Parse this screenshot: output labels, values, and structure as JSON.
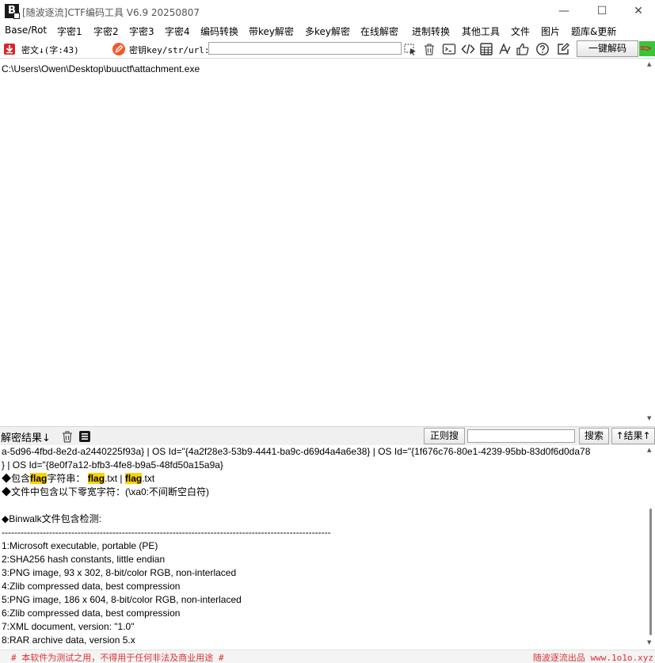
{
  "window": {
    "logo_text": "B",
    "title": "[随波逐流]CTF编码工具 V6.9  20250807",
    "minimize": "—",
    "maximize": "☐",
    "close": "✕"
  },
  "menu": [
    "Base/Rot",
    "字密1",
    "字密2",
    "字密3",
    "字密4",
    "编码转换",
    "带key解密",
    "多key解密",
    "在线解密",
    "进制转换",
    "其他工具",
    "文件",
    "图片",
    "题库&更新"
  ],
  "toolbar": {
    "cipher_label": "密文↓(字:43)",
    "key_label": "密钥key/str/url:",
    "key_value": "",
    "decode_button": "一键解码",
    "run_arrow": "=>"
  },
  "input": {
    "text": "C:\\Users\\Owen\\Desktop\\buuctf\\attachment.exe"
  },
  "result_bar": {
    "label": "解密结果↓",
    "regex_button": "正则搜",
    "search_value": "",
    "search_button": "搜索",
    "nav_button": "↑结果↑"
  },
  "output": {
    "line1": "a-5d96-4fbd-8e2d-a2440225f93a} | OS Id=\"{4a2f28e3-53b9-4441-ba9c-d69d4a4a6e38} | OS Id=\"{1f676c76-80e1-4239-95bb-83d0f6d0da78",
    "line2": "} | OS Id=\"{8e0f7a12-bfb3-4fe8-b9a5-48fd50a15a9a}",
    "flag_prefix": "◆包含",
    "flag_word": "flag",
    "flag_mid": "字符串：",
    "flag_file1_suffix": ".txt | ",
    "flag_file2_suffix": ".txt",
    "zero_width": "◆文件中包含以下零宽字符：(\\xa0:不间断空白符)",
    "binwalk_title": "◆Binwalk文件包含检测:",
    "separator": "--------------------------------------------------------------------------------------------------------",
    "binwalk_items": [
      "1:Microsoft executable, portable (PE)",
      "2:SHA256 hash constants, little endian",
      "3:PNG image, 93 x 302, 8-bit/color RGB, non-interlaced",
      "4:Zlib compressed data, best compression",
      "5:PNG image, 186 x 604, 8-bit/color RGB, non-interlaced",
      "6:Zlib compressed data, best compression",
      "7:XML document, version: \"1.0\"",
      "8:RAR archive data, version 5.x"
    ]
  },
  "status": {
    "left": "# 本软件为测试之用，不得用于任何非法及商业用途 #",
    "right": "随波逐流出品 www.1o1o.xyz"
  },
  "colors": {
    "accent_red": "#e03030",
    "highlight": "#ffd400",
    "run_green": "#39c53a"
  }
}
